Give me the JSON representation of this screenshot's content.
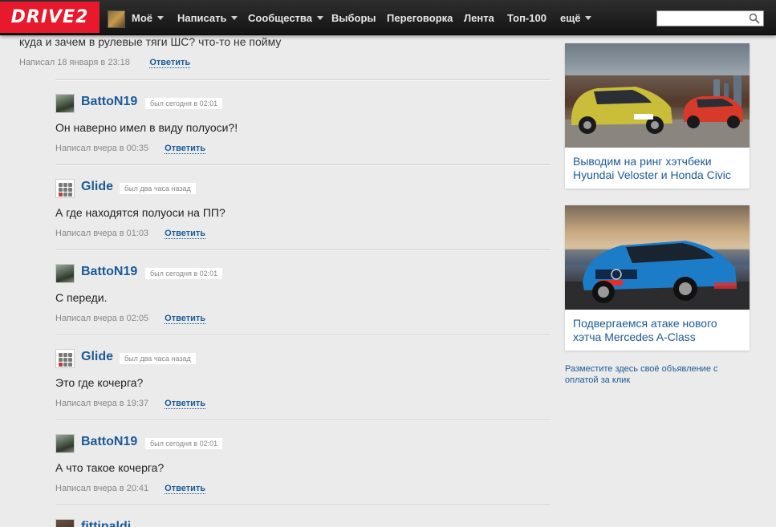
{
  "header": {
    "logo": "DRIVE2",
    "nav": [
      {
        "label": "Моё",
        "caret": true
      },
      {
        "label": "Написать",
        "caret": true
      },
      {
        "label": "Сообщества",
        "caret": true
      },
      {
        "label": "Выборы",
        "caret": false
      },
      {
        "label": "Переговорка",
        "caret": false
      },
      {
        "label": "Лента",
        "caret": false
      },
      {
        "label": "Топ-100",
        "caret": false
      },
      {
        "label": "ещё",
        "caret": true
      }
    ],
    "search": {
      "value": "",
      "placeholder": ""
    }
  },
  "top_comment": {
    "text": "куда и зачем в рулевые тяги ШС? что-то не пойму",
    "meta": "Написал 18 января в 23:18",
    "reply": "Ответить"
  },
  "comments": [
    {
      "author": "BattoN19",
      "status": "был сегодня в 02:01",
      "text": "Он наверно имел в виду полуоси?!",
      "meta": "Написал вчера в 00:35",
      "reply": "Ответить"
    },
    {
      "author": "Glide",
      "status": "был два часа назад",
      "text": "А где находятся полуоси на ПП?",
      "meta": "Написал вчера в 01:03",
      "reply": "Ответить"
    },
    {
      "author": "BattoN19",
      "status": "был сегодня в 02:01",
      "text": "С переди.",
      "meta": "Написал вчера в 02:05",
      "reply": "Ответить"
    },
    {
      "author": "Glide",
      "status": "был два часа назад",
      "text": "Это где кочерга?",
      "meta": "Написал вчера в 19:37",
      "reply": "Ответить"
    },
    {
      "author": "BattoN19",
      "status": "был сегодня в 02:01",
      "text": "А что такое кочерга?",
      "meta": "Написал вчера в 20:41",
      "reply": "Ответить"
    },
    {
      "author": "fittipaldi",
      "status": "",
      "text": "",
      "meta": "",
      "reply": ""
    }
  ],
  "sidebar": {
    "cards": [
      {
        "title": "Выводим на ринг хэтчбеки Hyundai Veloster и Honda Civic"
      },
      {
        "title": "Подвергаемся атаке нового хэтча Mercedes A-Class"
      }
    ],
    "ad_link": "Разместите здесь своё объявление с оплатой за клик"
  }
}
